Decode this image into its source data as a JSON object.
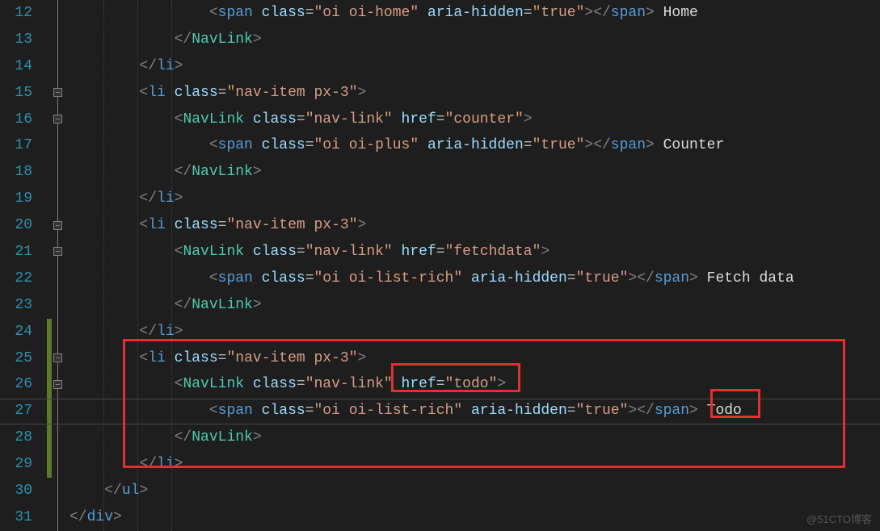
{
  "lineNumbers": [
    "12",
    "13",
    "14",
    "15",
    "16",
    "17",
    "18",
    "19",
    "20",
    "21",
    "22",
    "23",
    "24",
    "25",
    "26",
    "27",
    "28",
    "29",
    "30",
    "31"
  ],
  "watermark": "@51CTO博客",
  "code": {
    "l12": {
      "spanTag": "span",
      "classAttr": "class",
      "eq": "=",
      "classVal": "\"oi oi-home\"",
      "ariaAttr": "aria-hidden",
      "ariaVal": "\"true\"",
      "closeSpan": "span",
      "text": " Home"
    },
    "l13": {
      "closeComp": "NavLink"
    },
    "l14": {
      "closeLi": "li"
    },
    "l15": {
      "liTag": "li",
      "classAttr": "class",
      "eq": "=",
      "classVal": "\"nav-item px-3\""
    },
    "l16": {
      "comp": "NavLink",
      "classAttr": "class",
      "eq": "=",
      "classVal": "\"nav-link\"",
      "hrefAttr": "href",
      "hrefVal": "\"counter\""
    },
    "l17": {
      "spanTag": "span",
      "classAttr": "class",
      "eq": "=",
      "classVal": "\"oi oi-plus\"",
      "ariaAttr": "aria-hidden",
      "ariaVal": "\"true\"",
      "closeSpan": "span",
      "text": " Counter"
    },
    "l18": {
      "closeComp": "NavLink"
    },
    "l19": {
      "closeLi": "li"
    },
    "l20": {
      "liTag": "li",
      "classAttr": "class",
      "eq": "=",
      "classVal": "\"nav-item px-3\""
    },
    "l21": {
      "comp": "NavLink",
      "classAttr": "class",
      "eq": "=",
      "classVal": "\"nav-link\"",
      "hrefAttr": "href",
      "hrefVal": "\"fetchdata\""
    },
    "l22": {
      "spanTag": "span",
      "classAttr": "class",
      "eq": "=",
      "classVal": "\"oi oi-list-rich\"",
      "ariaAttr": "aria-hidden",
      "ariaVal": "\"true\"",
      "closeSpan": "span",
      "text": " Fetch data"
    },
    "l23": {
      "closeComp": "NavLink"
    },
    "l24": {
      "closeLi": "li"
    },
    "l25": {
      "liTag": "li",
      "classAttr": "class",
      "eq": "=",
      "classVal": "\"nav-item px-3\""
    },
    "l26": {
      "comp": "NavLink",
      "classAttr": "class",
      "eq": "=",
      "classVal": "\"nav-link\"",
      "hrefAttr": "href",
      "hrefVal": "\"todo\""
    },
    "l27": {
      "spanTag": "span",
      "classAttr": "class",
      "eq": "=",
      "classVal": "\"oi oi-list-rich\"",
      "ariaAttr": "aria-hidden",
      "ariaVal": "\"true\"",
      "closeSpan": "span",
      "text": "Todo"
    },
    "l28": {
      "closeComp": "NavLink"
    },
    "l29": {
      "closeLi": "li"
    },
    "l30": {
      "closeUl": "ul"
    },
    "l31": {
      "closeDiv": "div"
    }
  }
}
